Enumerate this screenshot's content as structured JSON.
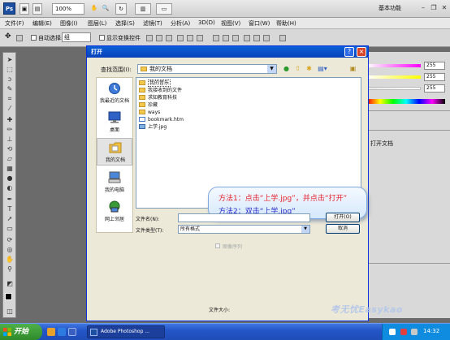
{
  "app": {
    "logo_text": "Ps",
    "zoom": "100%",
    "workspace": "基本功能",
    "window_controls": [
      "minimize",
      "restore",
      "close"
    ]
  },
  "menu": [
    "文件(F)",
    "编辑(E)",
    "图像(I)",
    "图层(L)",
    "选择(S)",
    "滤镜(T)",
    "分析(A)",
    "3D(D)",
    "视图(V)",
    "窗口(W)",
    "帮助(H)"
  ],
  "options_bar": {
    "auto_select_label": "自动选择:",
    "auto_select_value": "组",
    "show_transform_label": "显示变换控件"
  },
  "panels": {
    "sliders": [
      {
        "value": "255",
        "gradient": "#ff00ff"
      },
      {
        "value": "255",
        "gradient": "#ffff00"
      },
      {
        "value": "255",
        "gradient": "#ffffff"
      }
    ],
    "open_doc_label": "打开文档"
  },
  "dialog": {
    "title": "打开",
    "help": "?",
    "close": "×",
    "look_in_label": "查找范围(I):",
    "look_in_value": "我的文档",
    "places": [
      {
        "label": "我最近的文档",
        "icon": "recent-documents-icon",
        "color": "#3d7ad8"
      },
      {
        "label": "桌面",
        "icon": "desktop-icon",
        "color": "#2f62c4"
      },
      {
        "label": "我的文档",
        "icon": "my-documents-icon",
        "color": "#f0c040",
        "selected": true
      },
      {
        "label": "我的电脑",
        "icon": "my-computer-icon",
        "color": "#4b87d8"
      },
      {
        "label": "网上邻居",
        "icon": "network-places-icon",
        "color": "#3a9a3a"
      }
    ],
    "files": [
      {
        "name": "我的音乐",
        "type": "folder",
        "selected": true
      },
      {
        "name": "我接收到的文件",
        "type": "folder"
      },
      {
        "name": "求知教育科技",
        "type": "folder"
      },
      {
        "name": "珍藏",
        "type": "folder"
      },
      {
        "name": "ways",
        "type": "folder"
      },
      {
        "name": "bookmark.htm",
        "type": "file"
      },
      {
        "name": "上学.jpg",
        "type": "image"
      }
    ],
    "callout_line1": "方法1：点击“上学.jpg”，并点击“打开”",
    "callout_line2": "方法2：双击“上学.jpg”",
    "filename_label": "文件名(N):",
    "filename_value": "",
    "filetype_label": "文件类型(T):",
    "filetype_value": "所有格式",
    "open_button": "打开(O)",
    "cancel_button": "取消",
    "image_sequence_label": "图像序列",
    "file_size_label": "文件大小:"
  },
  "taskbar": {
    "start_label": "开始",
    "task_label": "Adobe Photoshop ...",
    "clock": "14:32",
    "watermark": "考无忧Easykao"
  }
}
